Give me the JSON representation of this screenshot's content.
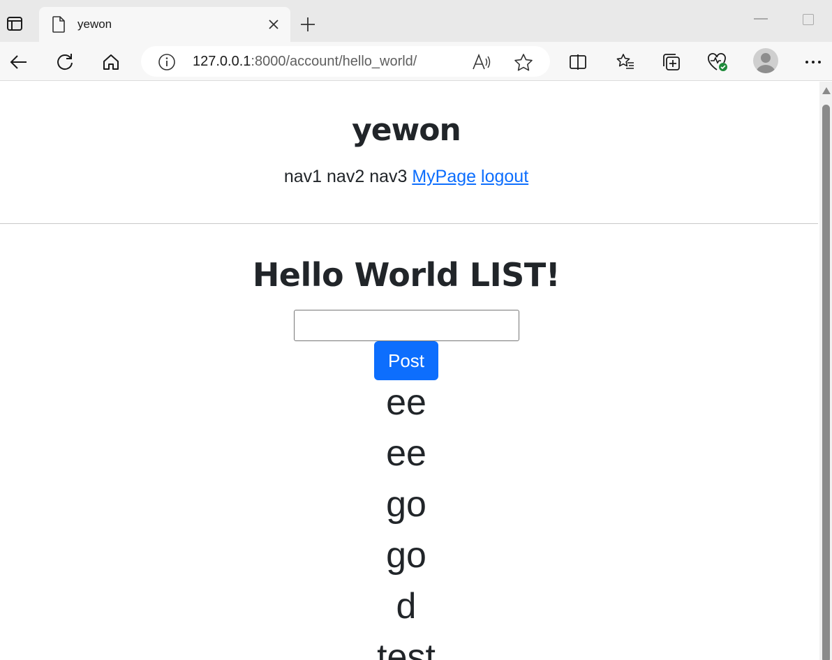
{
  "browser": {
    "tab": {
      "title": "yewon"
    },
    "address": {
      "host": "127.0.0.1",
      "path": ":8000/account/hello_world/"
    }
  },
  "page": {
    "site_title": "yewon",
    "nav": {
      "items": [
        "nav1",
        "nav2",
        "nav3"
      ],
      "links": [
        "MyPage",
        "logout"
      ]
    },
    "list_title": "Hello World LIST!",
    "input": {
      "value": "",
      "placeholder": ""
    },
    "post_button_label": "Post",
    "items": [
      "ee",
      "ee",
      "go",
      "go",
      "d",
      "test"
    ]
  },
  "colors": {
    "primary": "#0d6efd",
    "text": "#212529",
    "link": "#0d6efd"
  },
  "icons": [
    "tab-actions-icon",
    "document-icon",
    "close-icon",
    "plus-icon",
    "back-icon",
    "refresh-icon",
    "home-icon",
    "info-icon",
    "read-aloud-icon",
    "favorite-star-icon",
    "split-screen-icon",
    "favorites-icon",
    "collections-icon",
    "browser-essentials-icon",
    "profile-icon",
    "more-icon"
  ]
}
